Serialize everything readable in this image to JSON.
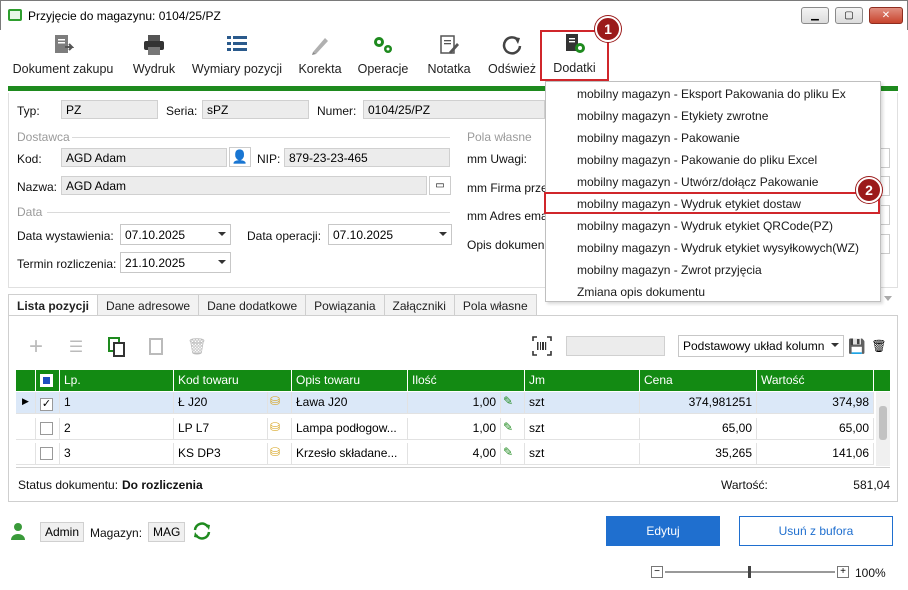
{
  "window": {
    "title": "Przyjęcie do magazynu: 0104/25/PZ"
  },
  "toolbar": [
    {
      "label": "Dokument zakupu",
      "icon": "document-export-icon"
    },
    {
      "label": "Wydruk",
      "icon": "printer-icon"
    },
    {
      "label": "Wymiary pozycji",
      "icon": "list-icon"
    },
    {
      "label": "Korekta",
      "icon": "pencil-icon"
    },
    {
      "label": "Operacje",
      "icon": "gears-icon"
    },
    {
      "label": "Notatka",
      "icon": "note-edit-icon"
    },
    {
      "label": "Odśwież",
      "icon": "refresh-icon"
    },
    {
      "label": "Dodatki",
      "icon": "addons-icon"
    }
  ],
  "header": {
    "typ_label": "Typ:",
    "typ_value": "PZ",
    "seria_label": "Seria:",
    "seria_value": "sPZ",
    "numer_label": "Numer:",
    "numer_value": "0104/25/PZ"
  },
  "supplier": {
    "section": "Dostawca",
    "kod_label": "Kod:",
    "kod_value": "AGD Adam",
    "nip_label": "NIP:",
    "nip_value": "879-23-23-465",
    "nazwa_label": "Nazwa:",
    "nazwa_value": "AGD Adam"
  },
  "dates": {
    "section": "Data",
    "wystawienia_label": "Data wystawienia:",
    "wystawienia_value": "07.10.2025",
    "operacji_label": "Data operacji:",
    "operacji_value": "07.10.2025",
    "termin_label": "Termin rozliczenia:",
    "termin_value": "21.10.2025"
  },
  "custom_fields": {
    "section": "Pola własne",
    "items": [
      "mm Uwagi:",
      "mm Firma prze",
      "mm Adres ema",
      "Opis dokumen"
    ]
  },
  "dropdown_menu": {
    "items": [
      "mobilny magazyn - Eksport Pakowania do pliku Ex",
      "mobilny magazyn - Etykiety zwrotne",
      "mobilny magazyn - Pakowanie",
      "mobilny magazyn - Pakowanie do pliku Excel",
      "mobilny magazyn - Utwórz/dołącz Pakowanie",
      "mobilny magazyn - Wydruk etykiet dostaw",
      "mobilny magazyn - Wydruk etykiet QRCode(PZ)",
      "mobilny magazyn - Wydruk etykiet wysyłkowych(WZ)",
      "mobilny magazyn - Zwrot przyjęcia",
      "Zmiana opis dokumentu"
    ],
    "highlighted_index": 5
  },
  "callouts": [
    "1",
    "2"
  ],
  "tabs": [
    "Lista pozycji",
    "Dane adresowe",
    "Dane dodatkowe",
    "Powiązania",
    "Załączniki",
    "Pola własne"
  ],
  "grid_toolbar": {
    "layout_select": "Podstawowy układ kolumn"
  },
  "grid": {
    "columns": [
      "Lp.",
      "Kod towaru",
      "Opis towaru",
      "Ilość",
      "Jm",
      "Cena",
      "Wartość"
    ],
    "rows": [
      {
        "lp": "1",
        "kod": "Ł J20",
        "opis": "Ława J20",
        "ilosc": "1,00",
        "jm": "szt",
        "cena": "374,981251",
        "wartosc": "374,98",
        "checked": true
      },
      {
        "lp": "2",
        "kod": "LP L7",
        "opis": "Lampa podłogow...",
        "ilosc": "1,00",
        "jm": "szt",
        "cena": "65,00",
        "wartosc": "65,00",
        "checked": false
      },
      {
        "lp": "3",
        "kod": "KS DP3",
        "opis": "Krzesło składane...",
        "ilosc": "4,00",
        "jm": "szt",
        "cena": "35,265",
        "wartosc": "141,06",
        "checked": false
      }
    ]
  },
  "summary": {
    "status_label": "Status dokumentu:",
    "status_value": "Do rozliczenia",
    "wartosc_label": "Wartość:",
    "wartosc_value": "581,04"
  },
  "footer": {
    "user": "Admin",
    "magazyn_label": "Magazyn:",
    "magazyn_value": "MAG",
    "edit_button": "Edytuj",
    "remove_button": "Usuń z bufora",
    "zoom_minus": "−",
    "zoom_plus": "+",
    "zoom": "100%"
  },
  "colors": {
    "accent_green": "#1e8a1e",
    "highlight_red": "#d0262b",
    "primary_blue": "#1f6fcf",
    "callout_red": "#9b1a1a"
  }
}
